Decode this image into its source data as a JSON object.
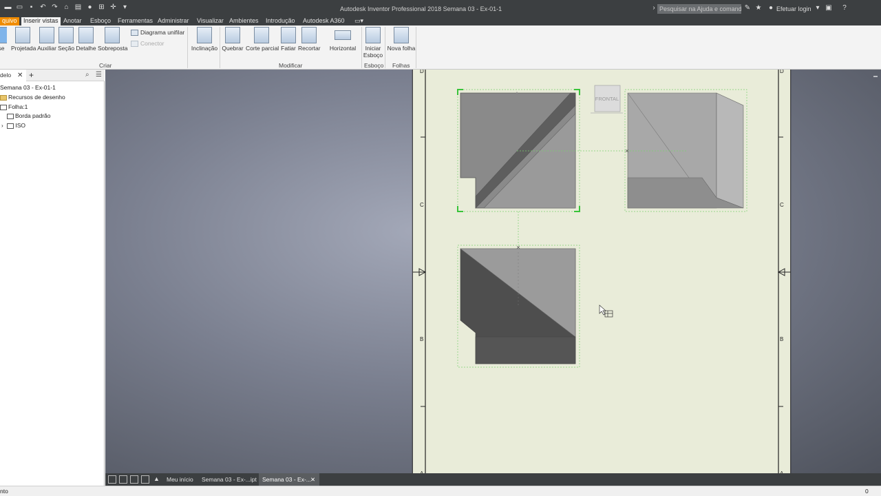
{
  "window": {
    "title": "Autodesk Inventor Professional 2018   Semana 03 - Ex-01-1",
    "search_placeholder": "Pesquisar na Ajuda e comandos...",
    "login_label": "Efetuar login"
  },
  "ribbon_tabs": [
    {
      "label": "quivo"
    },
    {
      "label": "Inserir vistas"
    },
    {
      "label": "Anotar"
    },
    {
      "label": "Esboço"
    },
    {
      "label": "Ferramentas"
    },
    {
      "label": "Administrar"
    },
    {
      "label": "Visualizar"
    },
    {
      "label": "Ambientes"
    },
    {
      "label": "Introdução"
    },
    {
      "label": "Autodesk A360"
    }
  ],
  "ribbon": {
    "create": {
      "label": "Criar",
      "buttons": [
        "se",
        "Projetada",
        "Auxiliar",
        "Seção",
        "Detalhe",
        "Sobreposta"
      ],
      "small": [
        "Diagrama unifilar",
        "Conector"
      ]
    },
    "modify": {
      "label": "Modificar",
      "buttons": [
        "Inclinação",
        "Quebrar",
        "Corte parcial",
        "Fatiar",
        "Recortar",
        "Horizontal"
      ]
    },
    "sketch": {
      "label": "Esboço",
      "button_line1": "Iniciar",
      "button_line2": "Esboço"
    },
    "sheets": {
      "label": "Folhas",
      "button": "Nova folha"
    }
  },
  "browser": {
    "tab_label": "delo",
    "items": [
      {
        "label": "Semana 03 - Ex-01-1"
      },
      {
        "label": "Recursos de desenho"
      },
      {
        "label": "Folha:1"
      },
      {
        "label": "Borda padrão"
      },
      {
        "label": "ISO"
      }
    ]
  },
  "drawing": {
    "view_cube_label": "FRONTAL",
    "border_letters": [
      "D",
      "C",
      "B",
      "A",
      "D",
      "C",
      "B",
      "A"
    ]
  },
  "doc_tabs": [
    {
      "label": "Meu início"
    },
    {
      "label": "Semana 03 - Ex-...ipt"
    },
    {
      "label": "Semana 03 - Ex-..."
    }
  ],
  "status": {
    "text": "nto",
    "count": "0"
  },
  "colors": {
    "accent": "#f08c00",
    "sheet": "#e9ecd9",
    "selection": "#39c33a"
  }
}
